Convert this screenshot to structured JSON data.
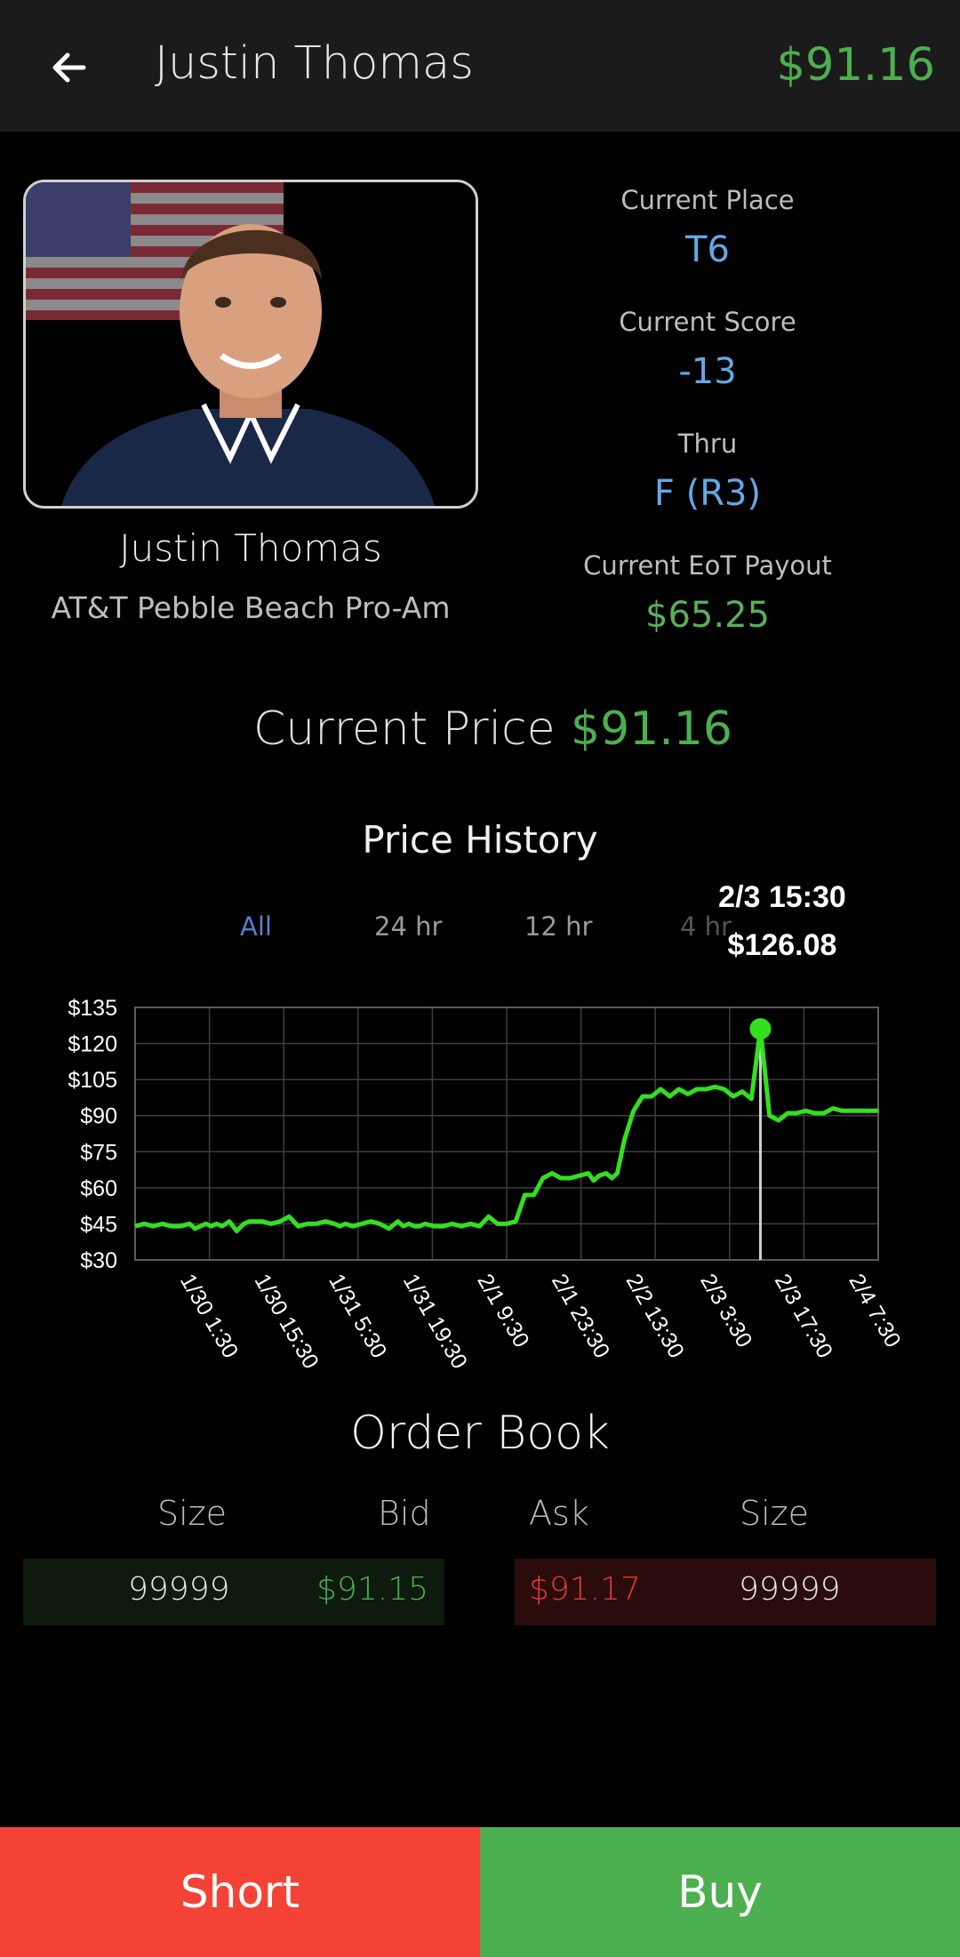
{
  "header": {
    "title": "Justin Thomas",
    "price": "$91.16"
  },
  "player": {
    "name": "Justin Thomas",
    "event": "AT&T Pebble Beach Pro-Am"
  },
  "stats": [
    {
      "label": "Current Place",
      "value": "T6"
    },
    {
      "label": "Current Score",
      "value": "-13"
    },
    {
      "label": "Thru",
      "value": "F (R3)"
    },
    {
      "label": "Current EoT Payout",
      "value": "$65.25"
    }
  ],
  "current_price": {
    "label": "Current Price",
    "value": "$91.16"
  },
  "price_history": {
    "title": "Price History",
    "tabs": [
      "All",
      "24 hr",
      "12 hr",
      "4 hr"
    ],
    "active_tab": "All",
    "tooltip": {
      "date": "2/3  15:30",
      "value": "$126.08"
    }
  },
  "chart_data": {
    "type": "line",
    "title": "Price History",
    "xlabel": "",
    "ylabel": "",
    "ylim": [
      30,
      135
    ],
    "y_ticks": [
      "$135",
      "$120",
      "$105",
      "$90",
      "$75",
      "$60",
      "$45",
      "$30"
    ],
    "x_ticks": [
      "1/30 1:30",
      "1/30 15:30",
      "1/31 5:30",
      "1/31 19:30",
      "2/1 9:30",
      "2/1 23:30",
      "2/2 13:30",
      "2/3 3:30",
      "2/3 17:30",
      "2/4 7:30"
    ],
    "grid": true,
    "line_color": "#33e01f",
    "x": [
      0,
      0.5,
      1,
      1.5,
      2,
      2.5,
      3,
      3.3,
      3.6,
      3.9,
      4.2,
      4.5,
      4.8,
      5.2,
      5.6,
      6,
      6.3,
      6.6,
      7,
      7.5,
      8,
      8.5,
      9,
      9.5,
      10,
      10.5,
      11,
      11.3,
      11.6,
      12,
      12.5,
      13,
      13.5,
      14,
      14.5,
      14.8,
      15.1,
      15.4,
      15.7,
      16,
      16.5,
      17,
      17.5,
      18,
      18.5,
      19,
      19.5,
      20,
      20.5,
      21,
      21.5,
      22,
      22.5,
      23,
      23.5,
      24,
      24.5,
      25,
      25.3,
      25.6,
      26,
      26.3,
      26.6,
      27,
      27.5,
      28,
      28.5,
      29,
      29.5,
      30,
      30.5,
      31,
      31.5,
      32,
      32.5,
      33,
      33.5,
      34,
      34.5,
      35,
      35.5,
      36,
      36.5,
      37,
      37.5,
      38,
      38.5,
      39,
      39.5,
      40,
      40.5,
      41
    ],
    "values": [
      44,
      45,
      44,
      45,
      44,
      44,
      45,
      43,
      44,
      45,
      44,
      45,
      44,
      46,
      42,
      45,
      46,
      46,
      46,
      45,
      46,
      48,
      44,
      45,
      45,
      46,
      45,
      44,
      45,
      44,
      45,
      46,
      45,
      43,
      46,
      44,
      45,
      44,
      44,
      45,
      44,
      44,
      45,
      44,
      45,
      44,
      48,
      45,
      45,
      46,
      57,
      57,
      64,
      66,
      64,
      64,
      65,
      66,
      63,
      65,
      66,
      64,
      66,
      80,
      92,
      98,
      98,
      101,
      98,
      101,
      99,
      101,
      101,
      102,
      101,
      98,
      100,
      97,
      126.08,
      90,
      88,
      91,
      91,
      92,
      91,
      91,
      93,
      92,
      92,
      92,
      92,
      92
    ],
    "marker_index": 78
  },
  "order_book": {
    "title": "Order Book",
    "headers": [
      "Size",
      "Bid",
      "Ask",
      "Size"
    ],
    "bid": {
      "size": "99999",
      "price": "$91.15"
    },
    "ask": {
      "price": "$91.17",
      "size": "99999"
    }
  },
  "actions": {
    "short": "Short",
    "buy": "Buy"
  },
  "colors": {
    "green": "#4caf50",
    "red": "#f44336",
    "blue": "#64a8e6"
  }
}
